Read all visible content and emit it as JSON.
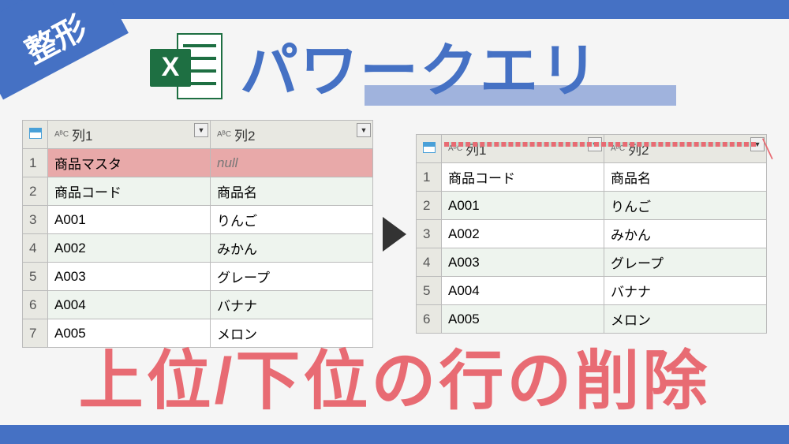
{
  "badge": "整形",
  "title": "パワークエリ",
  "excel_letter": "X",
  "columns": {
    "col1": "列1",
    "col2": "列2",
    "abc": "AᴮC"
  },
  "left_table": {
    "rows": [
      {
        "n": "1",
        "c1": "商品マスタ",
        "c2": "null",
        "red": true
      },
      {
        "n": "2",
        "c1": "商品コード",
        "c2": "商品名"
      },
      {
        "n": "3",
        "c1": "A001",
        "c2": "りんご"
      },
      {
        "n": "4",
        "c1": "A002",
        "c2": "みかん"
      },
      {
        "n": "5",
        "c1": "A003",
        "c2": "グレープ"
      },
      {
        "n": "6",
        "c1": "A004",
        "c2": "バナナ"
      },
      {
        "n": "7",
        "c1": "A005",
        "c2": "メロン"
      }
    ]
  },
  "right_table": {
    "rows": [
      {
        "n": "1",
        "c1": "商品コード",
        "c2": "商品名"
      },
      {
        "n": "2",
        "c1": "A001",
        "c2": "りんご"
      },
      {
        "n": "3",
        "c1": "A002",
        "c2": "みかん"
      },
      {
        "n": "4",
        "c1": "A003",
        "c2": "グレープ"
      },
      {
        "n": "5",
        "c1": "A004",
        "c2": "バナナ"
      },
      {
        "n": "6",
        "c1": "A005",
        "c2": "メロン"
      }
    ]
  },
  "footer": "上位/下位の行の削除"
}
